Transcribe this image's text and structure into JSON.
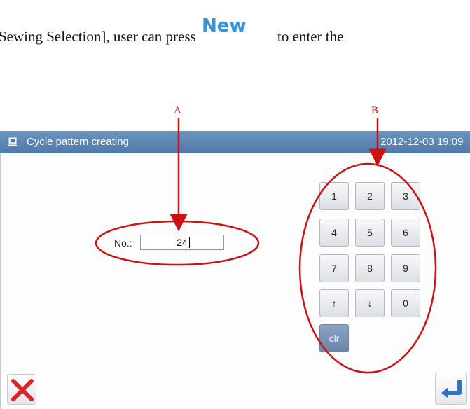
{
  "document": {
    "text_before": "Sewing Selection], user can press",
    "new_icon_label": "New",
    "text_after": "to enter the"
  },
  "annotations": {
    "label_a": "A",
    "label_b": "B",
    "color": "#d01010"
  },
  "window": {
    "title": "Cycle pattern creating",
    "datetime": "2012-12-03  19:09",
    "titlebar_color": "#5b83b2"
  },
  "form": {
    "no_label": "No.:",
    "no_value": "24"
  },
  "keypad": {
    "keys": [
      "1",
      "2",
      "3",
      "4",
      "5",
      "6",
      "7",
      "8",
      "9",
      "↑",
      "↓",
      "0",
      "clr"
    ]
  },
  "footer": {
    "cancel_icon": "cancel-x-icon",
    "enter_icon": "enter-return-icon"
  }
}
